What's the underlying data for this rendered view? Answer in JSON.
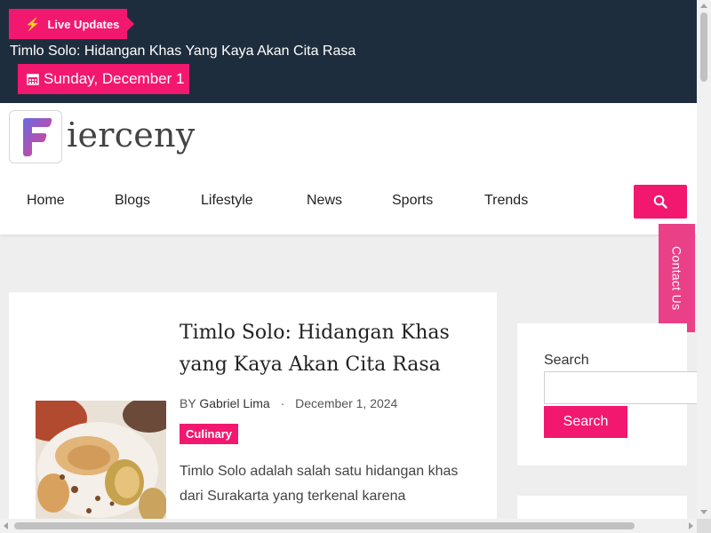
{
  "topbar": {
    "live_label": "Live Updates",
    "ticker_headline": "Timlo Solo: Hidangan Khas Yang Kaya Akan Cita Rasa",
    "date": "Sunday, December 1"
  },
  "header": {
    "logo_text": "ierceny",
    "nav": [
      "Home",
      "Blogs",
      "Lifestyle",
      "News",
      "Sports",
      "Trends"
    ]
  },
  "contact_tab": "Contact Us",
  "article": {
    "title": "Timlo Solo: Hidangan Khas yang Kaya Akan Cita Rasa",
    "byline_prefix": "BY",
    "author": "Gabriel Lima",
    "date": "December 1, 2024",
    "category": "Culinary",
    "excerpt": "Timlo Solo adalah salah satu hidangan khas dari Surakarta yang terkenal karena"
  },
  "sidebar": {
    "search_label": "Search",
    "search_value": "",
    "search_button": "Search"
  },
  "colors": {
    "accent": "#f2186f",
    "topbar": "#1e2d3d",
    "contact_tab": "#e94088"
  },
  "icons": {
    "live": "bolt-icon",
    "date": "calendar-icon",
    "search": "search-icon",
    "logo": "fierceny-f-logo"
  }
}
